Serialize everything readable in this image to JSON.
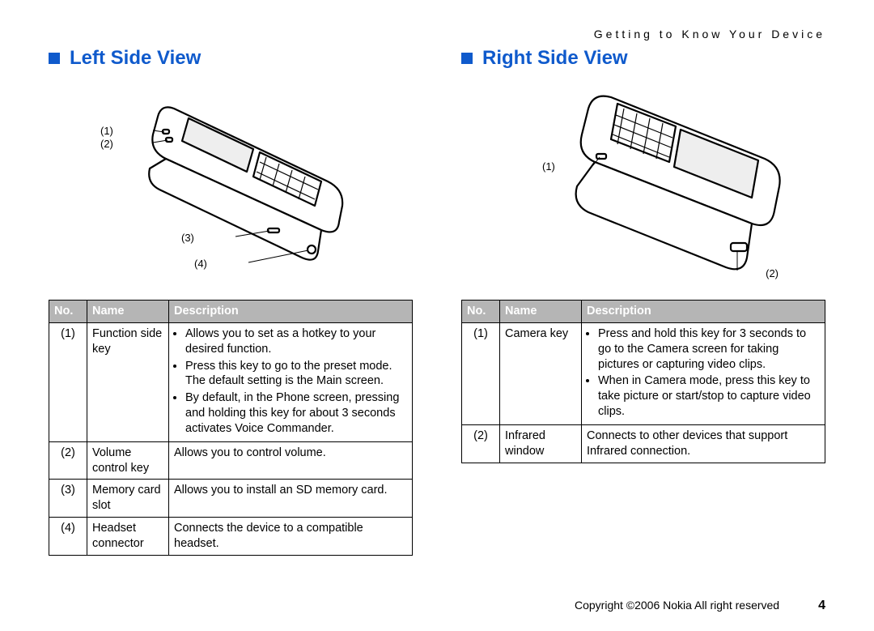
{
  "running_head": "Getting to Know Your Device",
  "left": {
    "heading": "Left Side View",
    "callouts": [
      "(1)",
      "(2)",
      "(3)",
      "(4)"
    ],
    "table": {
      "headers": {
        "no": "No.",
        "name": "Name",
        "desc": "Description"
      },
      "rows": [
        {
          "no": "(1)",
          "name": "Function side key",
          "desc_bullets": [
            "Allows you to set as a hotkey to your desired function.",
            "Press this key to go to the preset mode. The default setting is the Main screen.",
            "By default, in the Phone screen, pressing and holding this key for about 3 seconds activates Voice Commander."
          ]
        },
        {
          "no": "(2)",
          "name": "Volume control key",
          "desc_text": "Allows you to control volume."
        },
        {
          "no": "(3)",
          "name": "Memory card slot",
          "desc_text": "Allows you to install an SD memory card."
        },
        {
          "no": "(4)",
          "name": "Headset connector",
          "desc_text": "Connects the device to a compatible headset."
        }
      ]
    }
  },
  "right": {
    "heading": "Right Side View",
    "callouts": [
      "(1)",
      "(2)"
    ],
    "table": {
      "headers": {
        "no": "No.",
        "name": "Name",
        "desc": "Description"
      },
      "rows": [
        {
          "no": "(1)",
          "name": "Camera key",
          "desc_bullets": [
            "Press and hold this key for 3 seconds to go to the Camera screen for taking pictures or capturing video clips.",
            "When in Camera mode, press this key to take picture or start/stop to capture video clips."
          ]
        },
        {
          "no": "(2)",
          "name": "Infrared window",
          "desc_text": "Connects to other devices that support Infrared connection."
        }
      ]
    }
  },
  "footer": {
    "copyright": "Copyright ©2006 Nokia All right reserved",
    "page": "4"
  }
}
